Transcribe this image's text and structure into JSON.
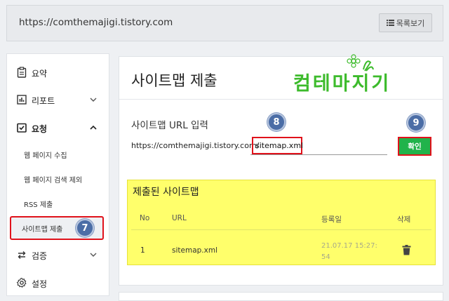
{
  "header": {
    "site_url": "https://comthemajigi.tistory.com",
    "list_button_label": "목록보기"
  },
  "sidebar": {
    "items": [
      {
        "label": "요약",
        "icon": "clipboard-icon"
      },
      {
        "label": "리포트",
        "icon": "bar-chart-icon"
      },
      {
        "label": "요청",
        "icon": "checkbox-icon",
        "expanded": true
      },
      {
        "label": "검증",
        "icon": "swap-icon"
      },
      {
        "label": "설정",
        "icon": "gear-icon"
      }
    ],
    "sub_items": [
      {
        "label": "웹 페이지 수집"
      },
      {
        "label": "웹 페이지 검색 제외"
      },
      {
        "label": "RSS 제출"
      },
      {
        "label": "사이트맵 제출",
        "active": true
      }
    ]
  },
  "main": {
    "title": "사이트맵 제출",
    "logo_text": "컴테마지기",
    "url_section_label": "사이트맵 URL 입력",
    "url_prefix": "https://comthemajigi.tistory.com/",
    "url_input_value": "sitemap.xml",
    "confirm_label": "확인"
  },
  "submitted": {
    "title": "제출된 사이트맵",
    "columns": [
      "No",
      "URL",
      "등록일",
      "삭제"
    ],
    "rows": [
      {
        "no": "1",
        "url": "sitemap.xml",
        "date_line1": "21.07.17 15:27:",
        "date_line2": "54"
      }
    ]
  },
  "badges": [
    "7",
    "8",
    "9"
  ],
  "colors": {
    "accent_green": "#21b34b",
    "highlight_yellow": "#ffff6b",
    "annotation_red": "#e0121b",
    "badge_blue": "#4b6da6"
  }
}
